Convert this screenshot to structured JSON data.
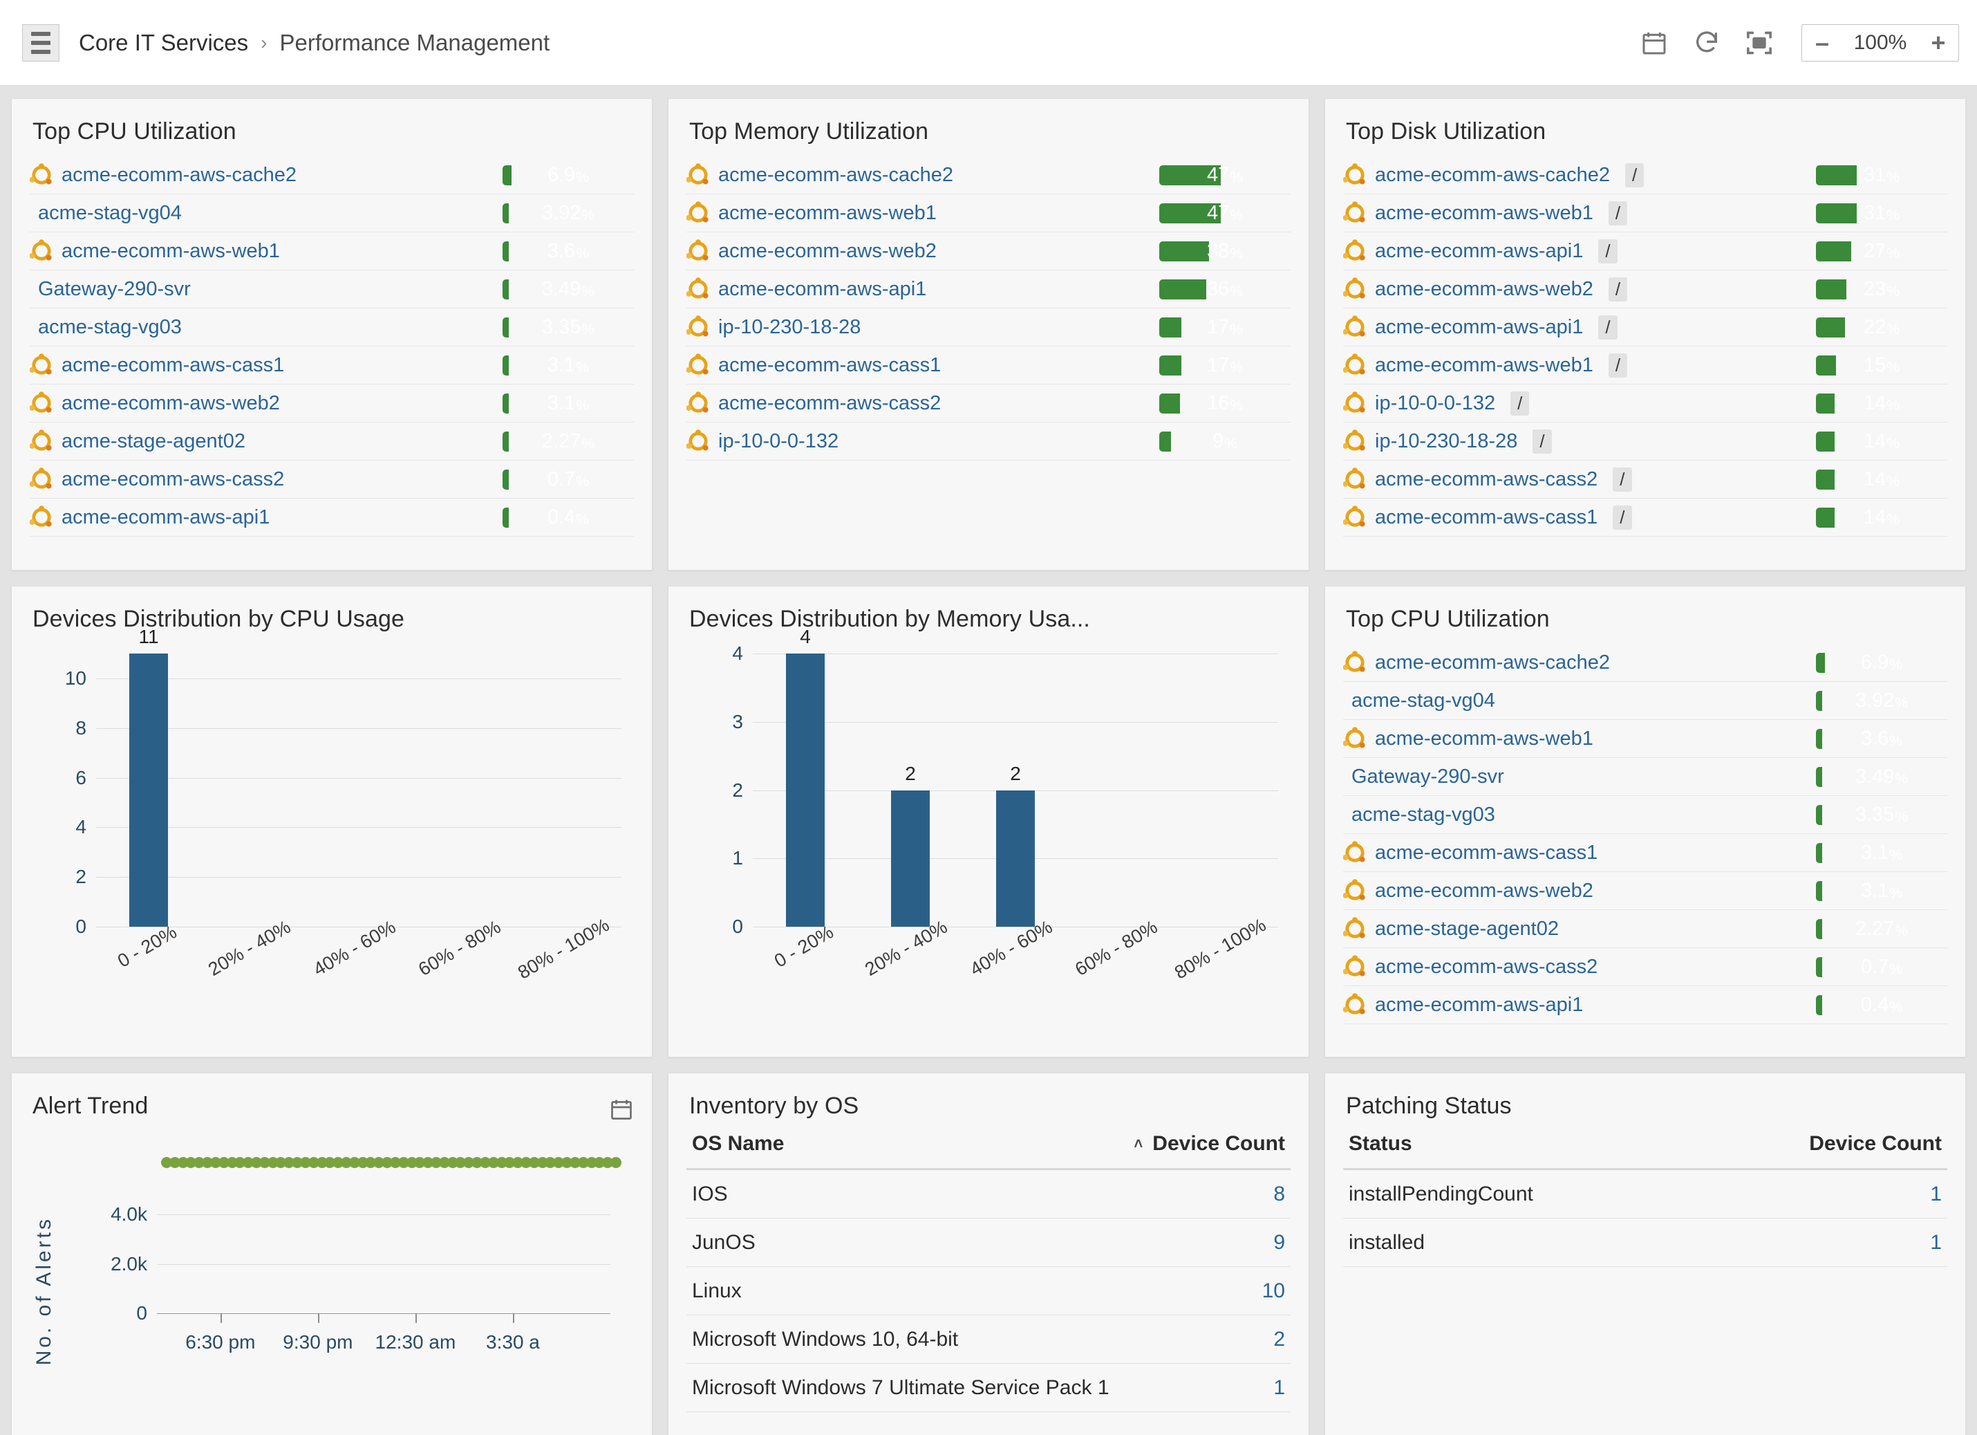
{
  "header": {
    "menu_icon": "hamburger-icon",
    "breadcrumb_root": "Core IT Services",
    "breadcrumb_separator": "›",
    "breadcrumb_current": "Performance Management",
    "toolbar": {
      "calendar_icon": "calendar-icon",
      "refresh_icon": "refresh-icon",
      "fullscreen_icon": "fullscreen-icon",
      "zoom_out_label": "–",
      "zoom_value": "100%",
      "zoom_in_label": "+"
    }
  },
  "colors": {
    "bar_fill": "#3a8a3a",
    "bar_track": "#999999",
    "chart_bar": "#2a6088",
    "trend_line": "#7aa33f",
    "link": "#2a6496",
    "page_bg": "#e3e3e3",
    "card_bg": "#f7f7f7"
  },
  "panels": {
    "top_cpu": {
      "title": "Top CPU Utilization",
      "rows": [
        {
          "icon": "ubuntu-icon",
          "name": "acme-ecomm-aws-cache2",
          "value": 6.9,
          "label": "6.9",
          "unit": "%"
        },
        {
          "icon": null,
          "name": "acme-stag-vg04",
          "value": 3.92,
          "label": "3.92",
          "unit": "%"
        },
        {
          "icon": "ubuntu-icon",
          "name": "acme-ecomm-aws-web1",
          "value": 3.6,
          "label": "3.6",
          "unit": "%"
        },
        {
          "icon": null,
          "name": "Gateway-290-svr",
          "value": 3.49,
          "label": "3.49",
          "unit": "%"
        },
        {
          "icon": null,
          "name": "acme-stag-vg03",
          "value": 3.35,
          "label": "3.35",
          "unit": "%"
        },
        {
          "icon": "ubuntu-icon",
          "name": "acme-ecomm-aws-cass1",
          "value": 3.1,
          "label": "3.1",
          "unit": "%"
        },
        {
          "icon": "ubuntu-icon",
          "name": "acme-ecomm-aws-web2",
          "value": 3.1,
          "label": "3.1",
          "unit": "%"
        },
        {
          "icon": "ubuntu-icon",
          "name": "acme-stage-agent02",
          "value": 2.27,
          "label": "2.27",
          "unit": "%"
        },
        {
          "icon": "ubuntu-icon",
          "name": "acme-ecomm-aws-cass2",
          "value": 0.7,
          "label": "0.7",
          "unit": "%"
        },
        {
          "icon": "ubuntu-icon",
          "name": "acme-ecomm-aws-api1",
          "value": 0.4,
          "label": "0.4",
          "unit": "%"
        }
      ]
    },
    "top_memory": {
      "title": "Top Memory Utilization",
      "rows": [
        {
          "icon": "ubuntu-icon",
          "name": "acme-ecomm-aws-cache2",
          "value": 47,
          "label": "47",
          "unit": "%"
        },
        {
          "icon": "ubuntu-icon",
          "name": "acme-ecomm-aws-web1",
          "value": 47,
          "label": "47",
          "unit": "%"
        },
        {
          "icon": "ubuntu-icon",
          "name": "acme-ecomm-aws-web2",
          "value": 38,
          "label": "38",
          "unit": "%"
        },
        {
          "icon": "ubuntu-icon",
          "name": "acme-ecomm-aws-api1",
          "value": 36,
          "label": "36",
          "unit": "%"
        },
        {
          "icon": "ubuntu-icon",
          "name": "ip-10-230-18-28",
          "value": 17,
          "label": "17",
          "unit": "%"
        },
        {
          "icon": "ubuntu-icon",
          "name": "acme-ecomm-aws-cass1",
          "value": 17,
          "label": "17",
          "unit": "%"
        },
        {
          "icon": "ubuntu-icon",
          "name": "acme-ecomm-aws-cass2",
          "value": 16,
          "label": "16",
          "unit": "%"
        },
        {
          "icon": "ubuntu-icon",
          "name": "ip-10-0-0-132",
          "value": 9,
          "label": "9",
          "unit": "%"
        }
      ]
    },
    "top_disk": {
      "title": "Top Disk Utilization",
      "rows": [
        {
          "icon": "ubuntu-icon",
          "name": "acme-ecomm-aws-cache2",
          "mount": "/",
          "value": 31,
          "label": "31",
          "unit": "%"
        },
        {
          "icon": "ubuntu-icon",
          "name": "acme-ecomm-aws-web1",
          "mount": "/",
          "value": 31,
          "label": "31",
          "unit": "%"
        },
        {
          "icon": "ubuntu-icon",
          "name": "acme-ecomm-aws-api1",
          "mount": "/",
          "value": 27,
          "label": "27",
          "unit": "%"
        },
        {
          "icon": "ubuntu-icon",
          "name": "acme-ecomm-aws-web2",
          "mount": "/",
          "value": 23,
          "label": "23",
          "unit": "%"
        },
        {
          "icon": "ubuntu-icon",
          "name": "acme-ecomm-aws-api1",
          "mount": "/",
          "value": 22,
          "label": "22",
          "unit": "%"
        },
        {
          "icon": "ubuntu-icon",
          "name": "acme-ecomm-aws-web1",
          "mount": "/",
          "value": 15,
          "label": "15",
          "unit": "%"
        },
        {
          "icon": "ubuntu-icon",
          "name": "ip-10-0-0-132",
          "mount": "/",
          "value": 14,
          "label": "14",
          "unit": "%"
        },
        {
          "icon": "ubuntu-icon",
          "name": "ip-10-230-18-28",
          "mount": "/",
          "value": 14,
          "label": "14",
          "unit": "%"
        },
        {
          "icon": "ubuntu-icon",
          "name": "acme-ecomm-aws-cass2",
          "mount": "/",
          "value": 14,
          "label": "14",
          "unit": "%"
        },
        {
          "icon": "ubuntu-icon",
          "name": "acme-ecomm-aws-cass1",
          "mount": "/",
          "value": 14,
          "label": "14",
          "unit": "%"
        }
      ]
    },
    "top_cpu_2": {
      "title": "Top CPU Utilization",
      "rows": [
        {
          "icon": "ubuntu-icon",
          "name": "acme-ecomm-aws-cache2",
          "value": 6.9,
          "label": "6.9",
          "unit": "%"
        },
        {
          "icon": null,
          "name": "acme-stag-vg04",
          "value": 3.92,
          "label": "3.92",
          "unit": "%"
        },
        {
          "icon": "ubuntu-icon",
          "name": "acme-ecomm-aws-web1",
          "value": 3.6,
          "label": "3.6",
          "unit": "%"
        },
        {
          "icon": null,
          "name": "Gateway-290-svr",
          "value": 3.49,
          "label": "3.49",
          "unit": "%"
        },
        {
          "icon": null,
          "name": "acme-stag-vg03",
          "value": 3.35,
          "label": "3.35",
          "unit": "%"
        },
        {
          "icon": "ubuntu-icon",
          "name": "acme-ecomm-aws-cass1",
          "value": 3.1,
          "label": "3.1",
          "unit": "%"
        },
        {
          "icon": "ubuntu-icon",
          "name": "acme-ecomm-aws-web2",
          "value": 3.1,
          "label": "3.1",
          "unit": "%"
        },
        {
          "icon": "ubuntu-icon",
          "name": "acme-stage-agent02",
          "value": 2.27,
          "label": "2.27",
          "unit": "%"
        },
        {
          "icon": "ubuntu-icon",
          "name": "acme-ecomm-aws-cass2",
          "value": 0.7,
          "label": "0.7",
          "unit": "%"
        },
        {
          "icon": "ubuntu-icon",
          "name": "acme-ecomm-aws-api1",
          "value": 0.4,
          "label": "0.4",
          "unit": "%"
        }
      ]
    },
    "alert_trend": {
      "title": "Alert Trend",
      "calendar_icon": "calendar-icon"
    },
    "inventory_by_os": {
      "title": "Inventory by OS",
      "columns": [
        "OS Name",
        "Device Count"
      ],
      "sort_indicator": "˄",
      "rows": [
        {
          "name": "IOS",
          "count": "8"
        },
        {
          "name": "JunOS",
          "count": "9"
        },
        {
          "name": "Linux",
          "count": "10"
        },
        {
          "name": "Microsoft Windows 10, 64-bit",
          "count": "2"
        },
        {
          "name": "Microsoft Windows 7 Ultimate Service Pack 1",
          "count": "1"
        }
      ]
    },
    "patching_status": {
      "title": "Patching Status",
      "columns": [
        "Status",
        "Device Count"
      ],
      "rows": [
        {
          "name": "installPendingCount",
          "count": "1"
        },
        {
          "name": "installed",
          "count": "1"
        }
      ]
    }
  },
  "chart_data": [
    {
      "type": "bar",
      "title": "Devices Distribution by CPU Usage",
      "categories": [
        "0 - 20%",
        "20% - 40%",
        "40% - 60%",
        "60% - 80%",
        "80% - 100%"
      ],
      "values": [
        11,
        0,
        0,
        0,
        0
      ],
      "data_labels": [
        "11",
        "",
        "",
        "",
        ""
      ],
      "xlabel": "",
      "ylabel": "",
      "ylim": [
        0,
        11
      ],
      "yticks": [
        0,
        2,
        4,
        6,
        8,
        10
      ],
      "grid": true,
      "legend": "none"
    },
    {
      "type": "bar",
      "title": "Devices Distribution by Memory Usa...",
      "categories": [
        "0 - 20%",
        "20% - 40%",
        "40% - 60%",
        "60% - 80%",
        "80% - 100%"
      ],
      "values": [
        4,
        2,
        2,
        0,
        0
      ],
      "data_labels": [
        "4",
        "2",
        "2",
        "",
        ""
      ],
      "xlabel": "",
      "ylabel": "",
      "ylim": [
        0,
        4
      ],
      "yticks": [
        0,
        1,
        2,
        3,
        4
      ],
      "grid": true,
      "legend": "none"
    },
    {
      "type": "line",
      "title": "Alert Trend",
      "ylabel": "No. of Alerts",
      "xlabel": "",
      "yticks": [
        "0",
        "2.0k",
        "4.0k"
      ],
      "ytick_values": [
        0,
        2000,
        4000
      ],
      "xticks": [
        "6:30 pm",
        "9:30 pm",
        "12:30 am",
        "3:30 a"
      ],
      "ylim": [
        0,
        7000
      ],
      "series": [
        {
          "name": "Alerts",
          "color": "#7aa33f",
          "constant_value": 6100,
          "n_points": 56
        }
      ],
      "grid": true,
      "legend": "none"
    }
  ]
}
